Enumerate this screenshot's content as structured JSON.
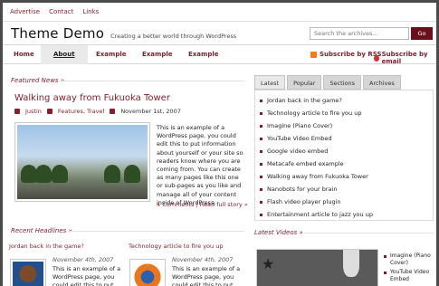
{
  "toplinks": [
    "Advertise",
    "Contact",
    "Links"
  ],
  "site": {
    "title": "Theme Demo",
    "tagline": "Creating a better world through WordPress"
  },
  "search": {
    "placeholder": "Search the archives...",
    "button": "Go"
  },
  "nav": {
    "items": [
      "Home",
      "About",
      "Example",
      "Example",
      "Example"
    ],
    "active": "About",
    "subscribe_rss": "Subscribe by RSS",
    "subscribe_email": "Subscribe by email"
  },
  "featured": {
    "heading": "Featured News »",
    "title": "Walking away from Fukuoka Tower",
    "author": "Justin",
    "categories": "Features, Travel",
    "date": "November 1st, 2007",
    "excerpt": "This is an example of a WordPress page, you could edit this to put information about yourself or your site so readers know where you are coming from. You can create as many pages like this one or sub-pages as you like and manage all of your content inside of WordPress.",
    "comments": "4 Comments",
    "read_more": "Read full story »",
    "separator": "|"
  },
  "tabs": {
    "items": [
      "Latest",
      "Popular",
      "Sections",
      "Archives"
    ],
    "active": "Latest",
    "list": [
      "Jordan back in the game?",
      "Technology article to fire you up",
      "Imagine (Piano Cover)",
      "YouTube Video Embed",
      "Google video embed",
      "Metacafe embed example",
      "Walking away from Fukuoka Tower",
      "Nanobots for your brain",
      "Flash video player plugin",
      "Entertainment article to jazz you up"
    ]
  },
  "recent": {
    "heading": "Recent Headlines »",
    "items": [
      {
        "title": "Jordan back in the game?",
        "date": "November 4th, 2007",
        "text": "This is an example of a WordPress page, you could edit this to put information"
      },
      {
        "title": "Technology article to fire you up",
        "date": "November 4th, 2007",
        "text": "This is an example of a WordPress page, you could edit this to put information"
      }
    ]
  },
  "videos": {
    "heading": "Latest Videos »",
    "list": [
      "Imagine (Piano Cover)",
      "YouTube Video Embed"
    ]
  },
  "colors": {
    "accent": "#7a1f2b",
    "button": "#6b0f1c",
    "rss": "#f07d1a"
  }
}
